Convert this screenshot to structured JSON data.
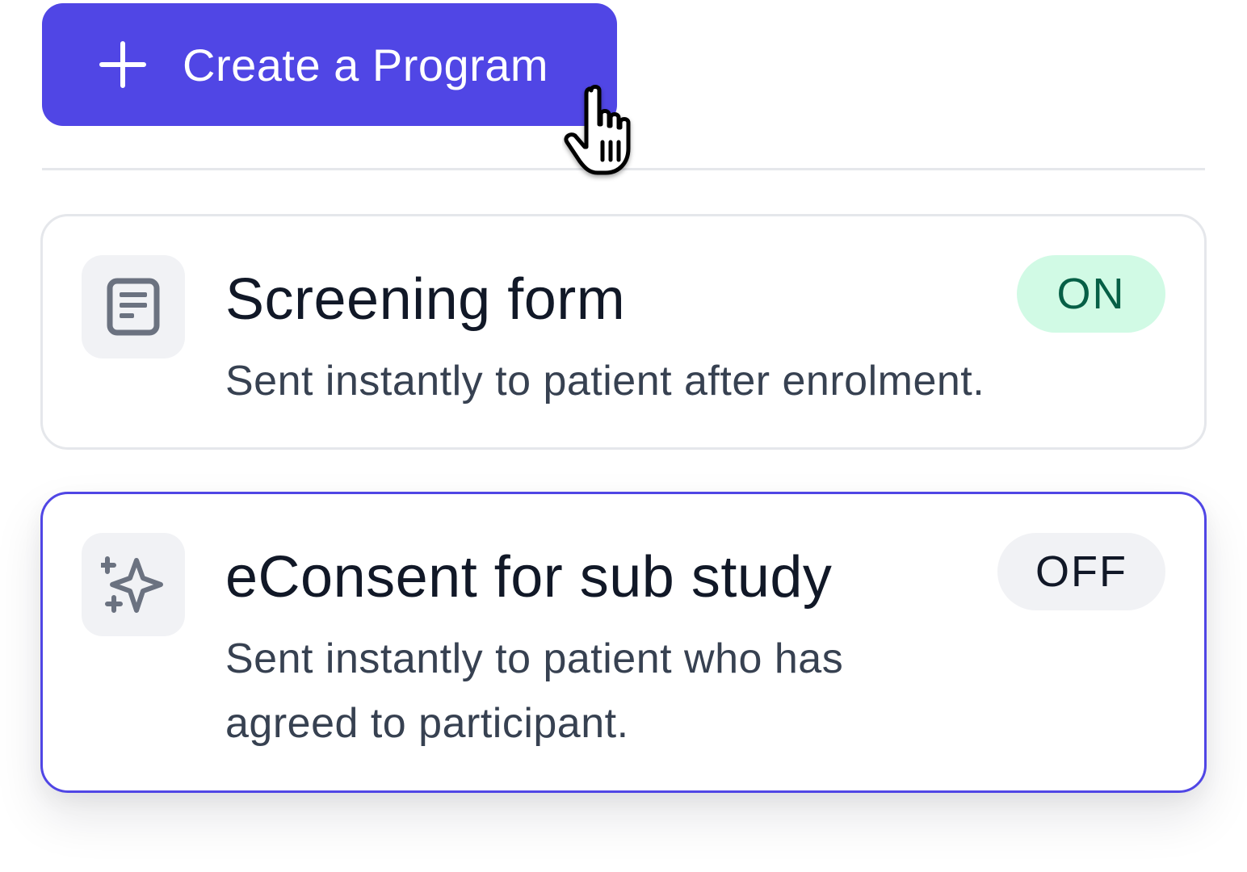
{
  "create_button": {
    "label": "Create a Program",
    "icon": "plus-icon"
  },
  "programs": [
    {
      "title": "Screening form",
      "description": "Sent instantly to patient after enrolment.",
      "status": "ON",
      "icon": "document-form-icon",
      "selected": false
    },
    {
      "title": "eConsent for sub study",
      "description": "Sent instantly to patient who has agreed to participant.",
      "status": "OFF",
      "icon": "sparkles-icon",
      "selected": true
    }
  ],
  "colors": {
    "accent": "#5046e5",
    "on_bg": "#d1fae5",
    "on_text": "#065f46",
    "off_bg": "#f1f2f5",
    "off_text": "#111827",
    "border": "#e5e7eb"
  },
  "cursor": "hand-pointer-icon"
}
